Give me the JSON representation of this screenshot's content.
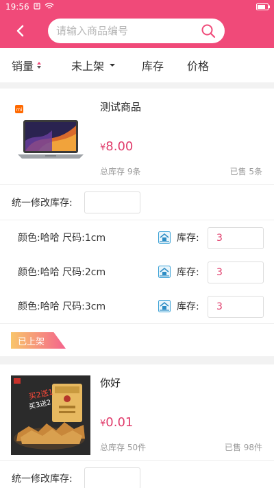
{
  "status": {
    "time": "19:56"
  },
  "search": {
    "placeholder": "请输入商品编号"
  },
  "filters": [
    {
      "label": "销量"
    },
    {
      "label": "未上架"
    },
    {
      "label": "库存"
    },
    {
      "label": "价格"
    }
  ],
  "products": [
    {
      "name": "测试商品",
      "currency": "¥",
      "price": "8.00",
      "total_stock": "总库存 9条",
      "sold": "已售 5条",
      "image": "laptop",
      "brand_badge": "mi",
      "batch_label": "统一修改库存:",
      "batch_value": "",
      "skus": [
        {
          "spec": "颜色:哈哈 尺码:1cm",
          "stock_label": "库存:",
          "stock": "3"
        },
        {
          "spec": "颜色:哈哈 尺码:2cm",
          "stock_label": "库存:",
          "stock": "3"
        },
        {
          "spec": "颜色:哈哈 尺码:3cm",
          "stock_label": "库存:",
          "stock": "3"
        }
      ],
      "status_tag": "已上架"
    },
    {
      "name": "你好",
      "currency": "¥",
      "price": "0.01",
      "total_stock": "总库存 50件",
      "sold": "已售 98件",
      "image": "snack-package",
      "batch_label": "统一修改库存:",
      "batch_value": ""
    }
  ],
  "colors": {
    "brand": "#f04a79",
    "price": "#e03c6b",
    "muted": "#9a9a9a"
  }
}
